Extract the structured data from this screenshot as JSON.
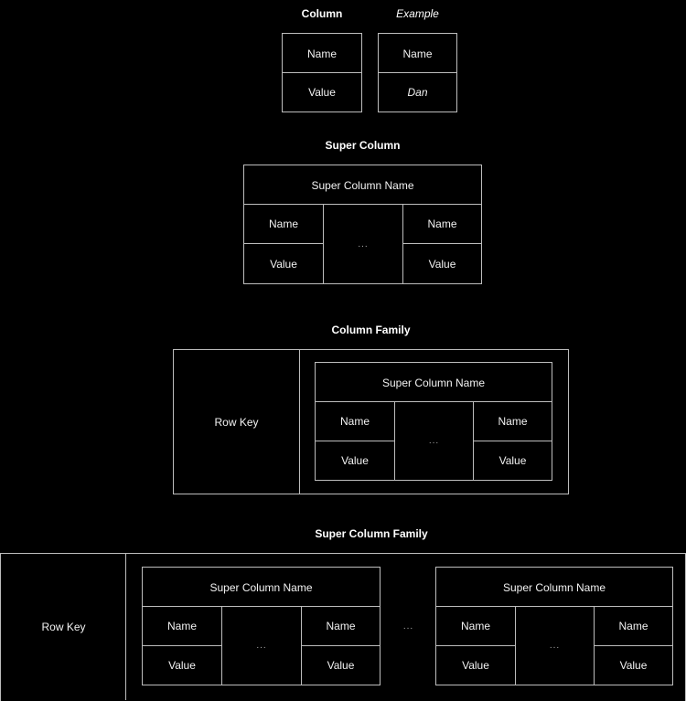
{
  "column_section": {
    "title": "Column",
    "example_title": "Example",
    "column": {
      "name": "Name",
      "value": "Value"
    },
    "example": {
      "name": "Name",
      "value": "Dan"
    }
  },
  "super_column_section": {
    "title": "Super Column",
    "super_column_name": "Super Column Name",
    "left": {
      "name": "Name",
      "value": "Value"
    },
    "ellipsis": "...",
    "right": {
      "name": "Name",
      "value": "Value"
    }
  },
  "column_family_section": {
    "title": "Column Family",
    "row_key": "Row Key",
    "super_column_name": "Super Column Name",
    "left": {
      "name": "Name",
      "value": "Value"
    },
    "ellipsis": "...",
    "right": {
      "name": "Name",
      "value": "Value"
    }
  },
  "super_column_family_section": {
    "title": "Super Column Family",
    "row_key": "Row Key",
    "between_ellipsis": "...",
    "super_columns": [
      {
        "super_column_name": "Super Column Name",
        "left": {
          "name": "Name",
          "value": "Value"
        },
        "ellipsis": "...",
        "right": {
          "name": "Name",
          "value": "Value"
        }
      },
      {
        "super_column_name": "Super Column Name",
        "left": {
          "name": "Name",
          "value": "Value"
        },
        "ellipsis": "...",
        "right": {
          "name": "Name",
          "value": "Value"
        }
      }
    ]
  }
}
